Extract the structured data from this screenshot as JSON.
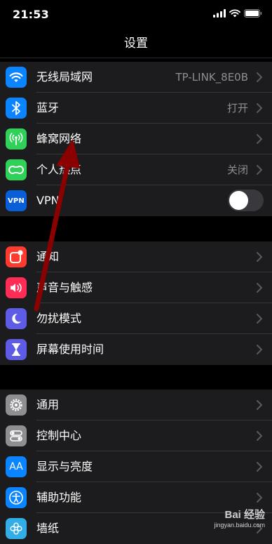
{
  "status": {
    "time": "21:53"
  },
  "nav": {
    "title": "设置"
  },
  "colors": {
    "wifi": "#0a84ff",
    "bluetooth": "#0a84ff",
    "cellular": "#30d158",
    "hotspot": "#30d158",
    "vpn": "#0a5fd8",
    "notifications": "#ff3b30",
    "sounds": "#ff2d55",
    "dnd": "#5e5ce6",
    "screentime": "#5e5ce6",
    "general": "#8e8e93",
    "control": "#8e8e93",
    "display": "#0a84ff",
    "accessibility": "#0a84ff",
    "wallpaper": "#32ade6",
    "annotation_arrow": "#8b0000"
  },
  "groups": [
    [
      {
        "icon": "wifi-icon",
        "label": "无线局域网",
        "value": "TP-LINK_8E0B"
      },
      {
        "icon": "bluetooth-icon",
        "label": "蓝牙",
        "value": "打开"
      },
      {
        "icon": "cellular-icon",
        "label": "蜂窝网络",
        "value": ""
      },
      {
        "icon": "hotspot-icon",
        "label": "个人热点",
        "value": "关闭"
      },
      {
        "icon": "vpn-icon",
        "icon_text": "VPN",
        "label": "VPN",
        "toggle": false
      }
    ],
    [
      {
        "icon": "notifications-icon",
        "label": "通知"
      },
      {
        "icon": "sounds-icon",
        "label": "声音与触感"
      },
      {
        "icon": "moon-icon",
        "label": "勿扰模式"
      },
      {
        "icon": "hourglass-icon",
        "label": "屏幕使用时间"
      }
    ],
    [
      {
        "icon": "gear-icon",
        "label": "通用"
      },
      {
        "icon": "control-center-icon",
        "label": "控制中心"
      },
      {
        "icon": "display-icon",
        "icon_text": "AA",
        "label": "显示与亮度"
      },
      {
        "icon": "accessibility-icon",
        "label": "辅助功能"
      },
      {
        "icon": "wallpaper-icon",
        "label": "墙纸"
      }
    ]
  ],
  "watermark": {
    "brand": "Bai 经验",
    "url": "jingyan.baidu.com"
  }
}
